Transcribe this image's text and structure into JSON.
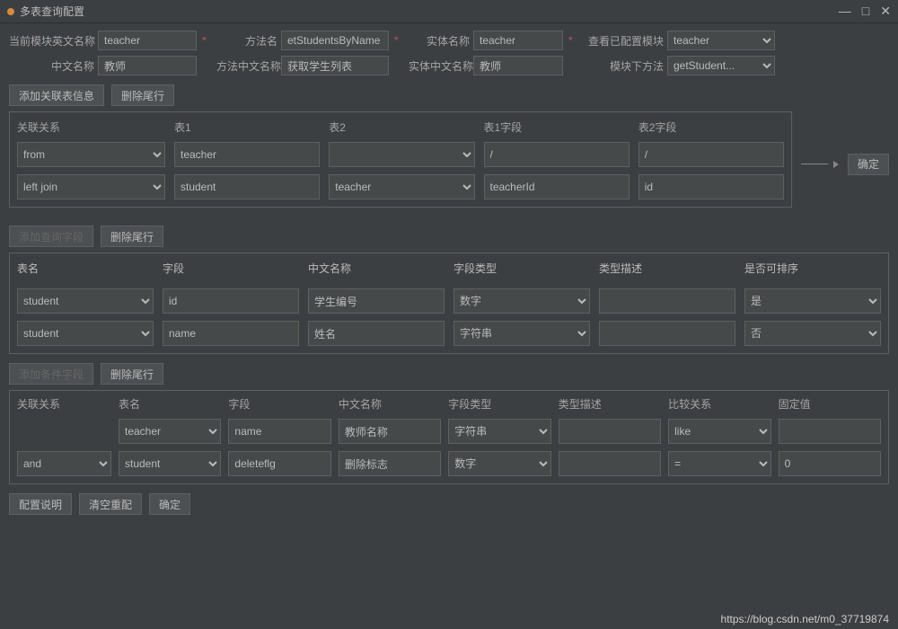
{
  "window": {
    "title": "多表查询配置"
  },
  "top": {
    "labels": {
      "moduleEn": "当前模块英文名称",
      "method": "方法名",
      "entity": "实体名称",
      "viewModule": "查看已配置模块",
      "cn": "中文名称",
      "methodCn": "方法中文名称",
      "entityCn": "实体中文名称",
      "moduleMethod": "模块下方法"
    },
    "values": {
      "moduleEn": "teacher",
      "method": "etStudentsByName",
      "entity": "teacher",
      "viewModule": "teacher",
      "cn": "教师",
      "methodCn": "获取学生列表",
      "entityCn": "教师",
      "moduleMethod": "getStudent..."
    }
  },
  "buttons": {
    "addJoin": "添加关联表信息",
    "delTail": "删除尾行",
    "addQuery": "添加查询字段",
    "addCond": "添加条件字段",
    "confirm": "确定",
    "configDesc": "配置说明",
    "clearReconf": "清空重配"
  },
  "joinPanel": {
    "headers": [
      "关联关系",
      "表1",
      "表2",
      "表1字段",
      "表2字段"
    ],
    "rows": [
      {
        "rel": "from",
        "t1": "teacher",
        "t2": "",
        "f1": "/",
        "f2": "/"
      },
      {
        "rel": "left join",
        "t1": "student",
        "t2": "teacher",
        "f1": "teacherId",
        "f2": "id"
      }
    ]
  },
  "queryPanel": {
    "headers": [
      "表名",
      "字段",
      "中文名称",
      "字段类型",
      "类型描述",
      "是否可排序"
    ],
    "rows": [
      {
        "table": "student",
        "field": "id",
        "cn": "学生编号",
        "type": "数字",
        "desc": "",
        "sortable": "是"
      },
      {
        "table": "student",
        "field": "name",
        "cn": "姓名",
        "type": "字符串",
        "desc": "",
        "sortable": "否"
      }
    ]
  },
  "condPanel": {
    "headers": [
      "关联关系",
      "表名",
      "字段",
      "中文名称",
      "字段类型",
      "类型描述",
      "比较关系",
      "固定值"
    ],
    "rows": [
      {
        "rel": "",
        "table": "teacher",
        "field": "name",
        "cn": "教师名称",
        "type": "字符串",
        "desc": "",
        "cmp": "like",
        "fixed": ""
      },
      {
        "rel": "and",
        "table": "student",
        "field": "deleteflg",
        "cn": "删除标志",
        "type": "数字",
        "desc": "",
        "cmp": "=",
        "fixed": "0"
      }
    ]
  },
  "footer": {
    "url": "https://blog.csdn.net/m0_37719874"
  }
}
